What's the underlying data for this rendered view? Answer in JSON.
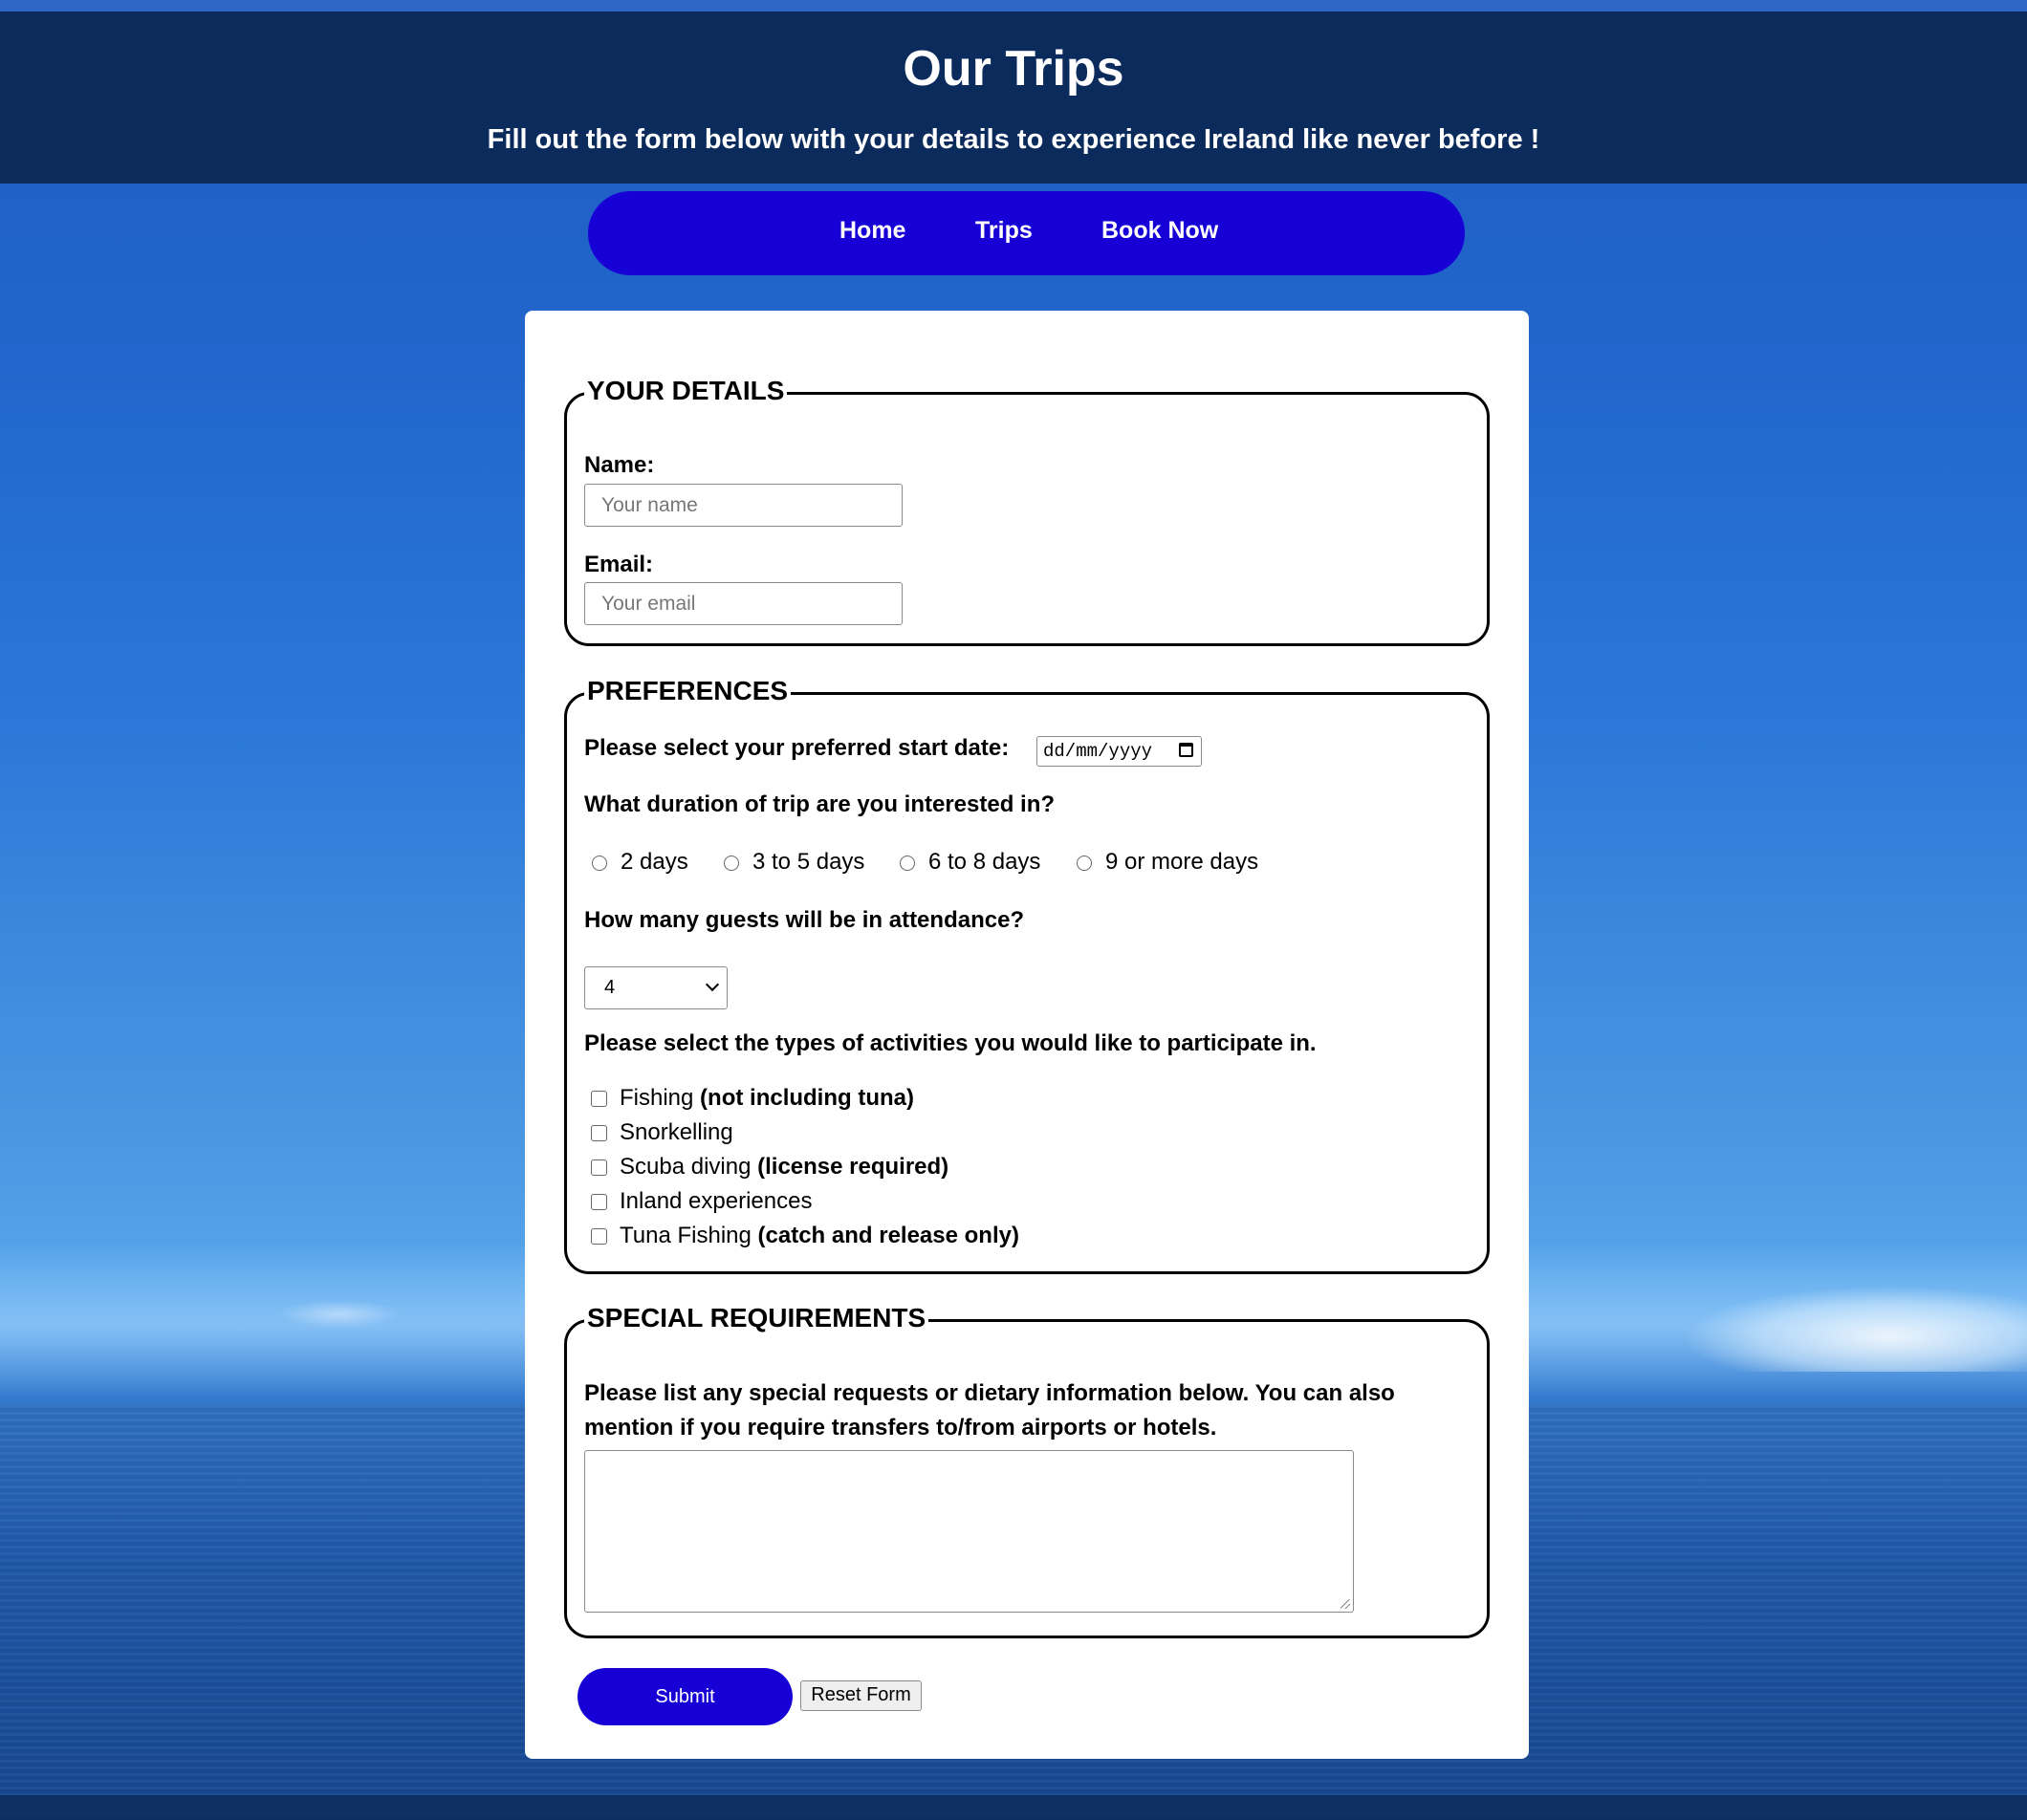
{
  "header": {
    "title": "Our Trips",
    "subtitle": "Fill out the form below with your details to experience Ireland like never before !"
  },
  "nav": {
    "items": [
      {
        "label": "Home"
      },
      {
        "label": "Trips"
      },
      {
        "label": "Book Now"
      }
    ],
    "color": "#1700d6"
  },
  "form": {
    "details": {
      "legend": "YOUR DETAILS",
      "name_label": "Name:",
      "name_placeholder": "Your name",
      "email_label": "Email:",
      "email_placeholder": "Your email"
    },
    "preferences": {
      "legend": "PREFERENCES",
      "start_date_label": "Please select your preferred start date:",
      "start_date_value": "dd/mm/yyyy",
      "duration_label": "What duration of trip are you interested in?",
      "duration_options": [
        "2 days",
        "3 to 5 days",
        "6 to 8 days",
        "9 or more days"
      ],
      "guests_label": "How many guests will be in attendance?",
      "guests_value": "4",
      "activities_label": "Please select the types of activities you would like to participate in.",
      "activities": [
        {
          "label": "Fishing",
          "note": "(not including tuna)"
        },
        {
          "label": "Snorkelling",
          "note": ""
        },
        {
          "label": "Scuba diving",
          "note": "(license required)"
        },
        {
          "label": "Inland experiences",
          "note": ""
        },
        {
          "label": "Tuna Fishing",
          "note": "(catch and release only)"
        }
      ]
    },
    "special": {
      "legend": "SPECIAL REQUIREMENTS",
      "line1": "Please list any special requests or dietary information below. You can also",
      "line2": "mention if you require transfers to/from airports or hotels.",
      "textarea_value": ""
    },
    "submit_label": "Submit",
    "reset_label": "Reset Form"
  }
}
